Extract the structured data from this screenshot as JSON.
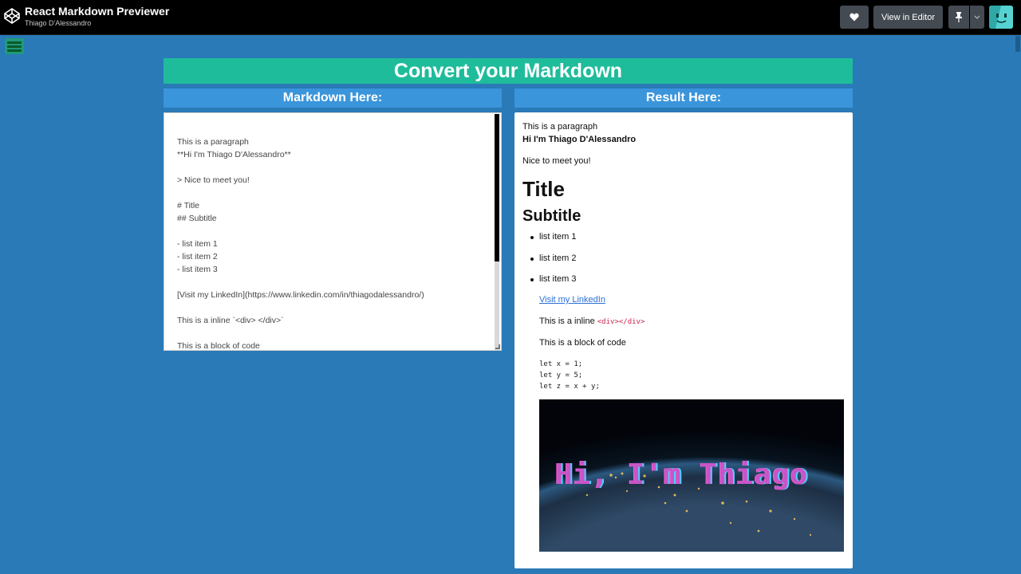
{
  "topbar": {
    "title": "React Markdown Previewer",
    "author": "Thiago D'Alessandro",
    "heart_icon": "heart-icon",
    "view_in_editor": "View in Editor",
    "pin_icon": "pin-icon",
    "caret_icon": "chevron-down-icon"
  },
  "header": {
    "title": "Convert your Markdown",
    "left_label": "Markdown Here:",
    "right_label": "Result Here:"
  },
  "editor": {
    "content": "This is a paragraph\n**Hi I'm Thiago D'Alessandro**\n\n> Nice to meet you!\n\n# Title\n## Subtitle\n\n- list item 1\n- list item 2\n- list item 3\n\n[Visit my LinkedIn](https://www.linkedin.com/in/thiagodalessandro/)\n\nThis is a inline `<div> </div>`\n\nThis is a block of code"
  },
  "preview": {
    "paragraph": "This is a paragraph",
    "strong": "Hi I'm Thiago D'Alessandro",
    "quote": "Nice to meet you!",
    "h1": "Title",
    "h2": "Subtitle",
    "list": [
      "list item 1",
      "list item 2",
      "list item 3"
    ],
    "link": "Visit my LinkedIn",
    "inline_prefix": "This is a inline ",
    "inline_code": "<div></div>",
    "block_label": "This is a block of code",
    "code_block": "let x = 1;\nlet y = 5;\nlet z = x + y;",
    "image_text": "Hi, I'm Thiago"
  },
  "colors": {
    "background": "#2a7ab8",
    "banner": "#1fbc9b",
    "panel_head": "#3a95db"
  }
}
